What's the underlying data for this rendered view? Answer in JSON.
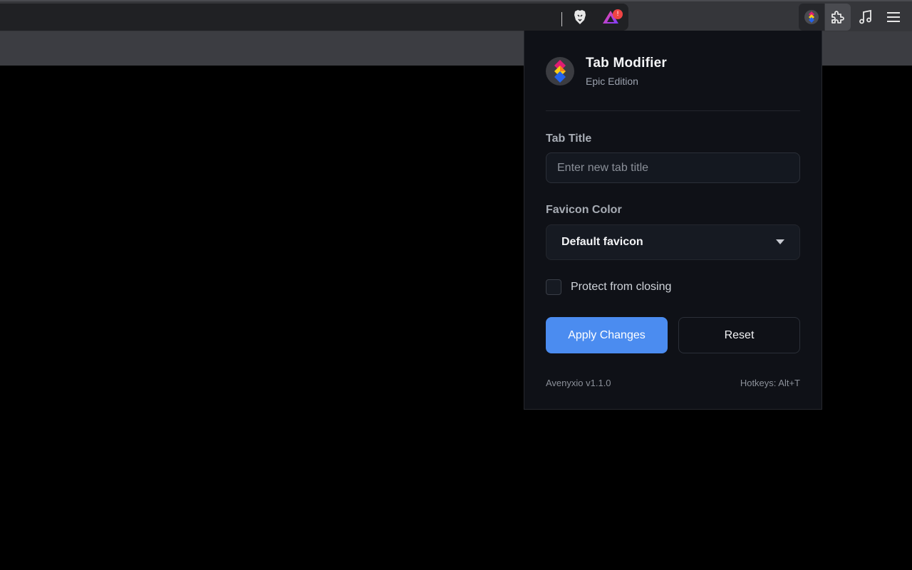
{
  "browser": {
    "rewards_badge": "!",
    "icons": [
      "brave-lion-icon",
      "brave-rewards-icon",
      "tab-modifier-extension-icon",
      "puzzle-icon",
      "music-note-icon",
      "hamburger-menu-icon"
    ]
  },
  "popup": {
    "app_title": "Tab Modifier",
    "app_subtitle": "Epic Edition",
    "tab_title_label": "Tab Title",
    "tab_title_placeholder": "Enter new tab title",
    "tab_title_value": "",
    "favicon_color_label": "Favicon Color",
    "favicon_color_selected": "Default favicon",
    "protect_label": "Protect from closing",
    "protect_checked": false,
    "apply_button": "Apply Changes",
    "reset_button": "Reset",
    "footer_left": "Avenyxio v1.1.0",
    "footer_right": "Hotkeys: Alt+T"
  },
  "colors": {
    "accent": "#4b8cf0",
    "panel_bg": "#0f1117",
    "badge": "#ef4444"
  }
}
